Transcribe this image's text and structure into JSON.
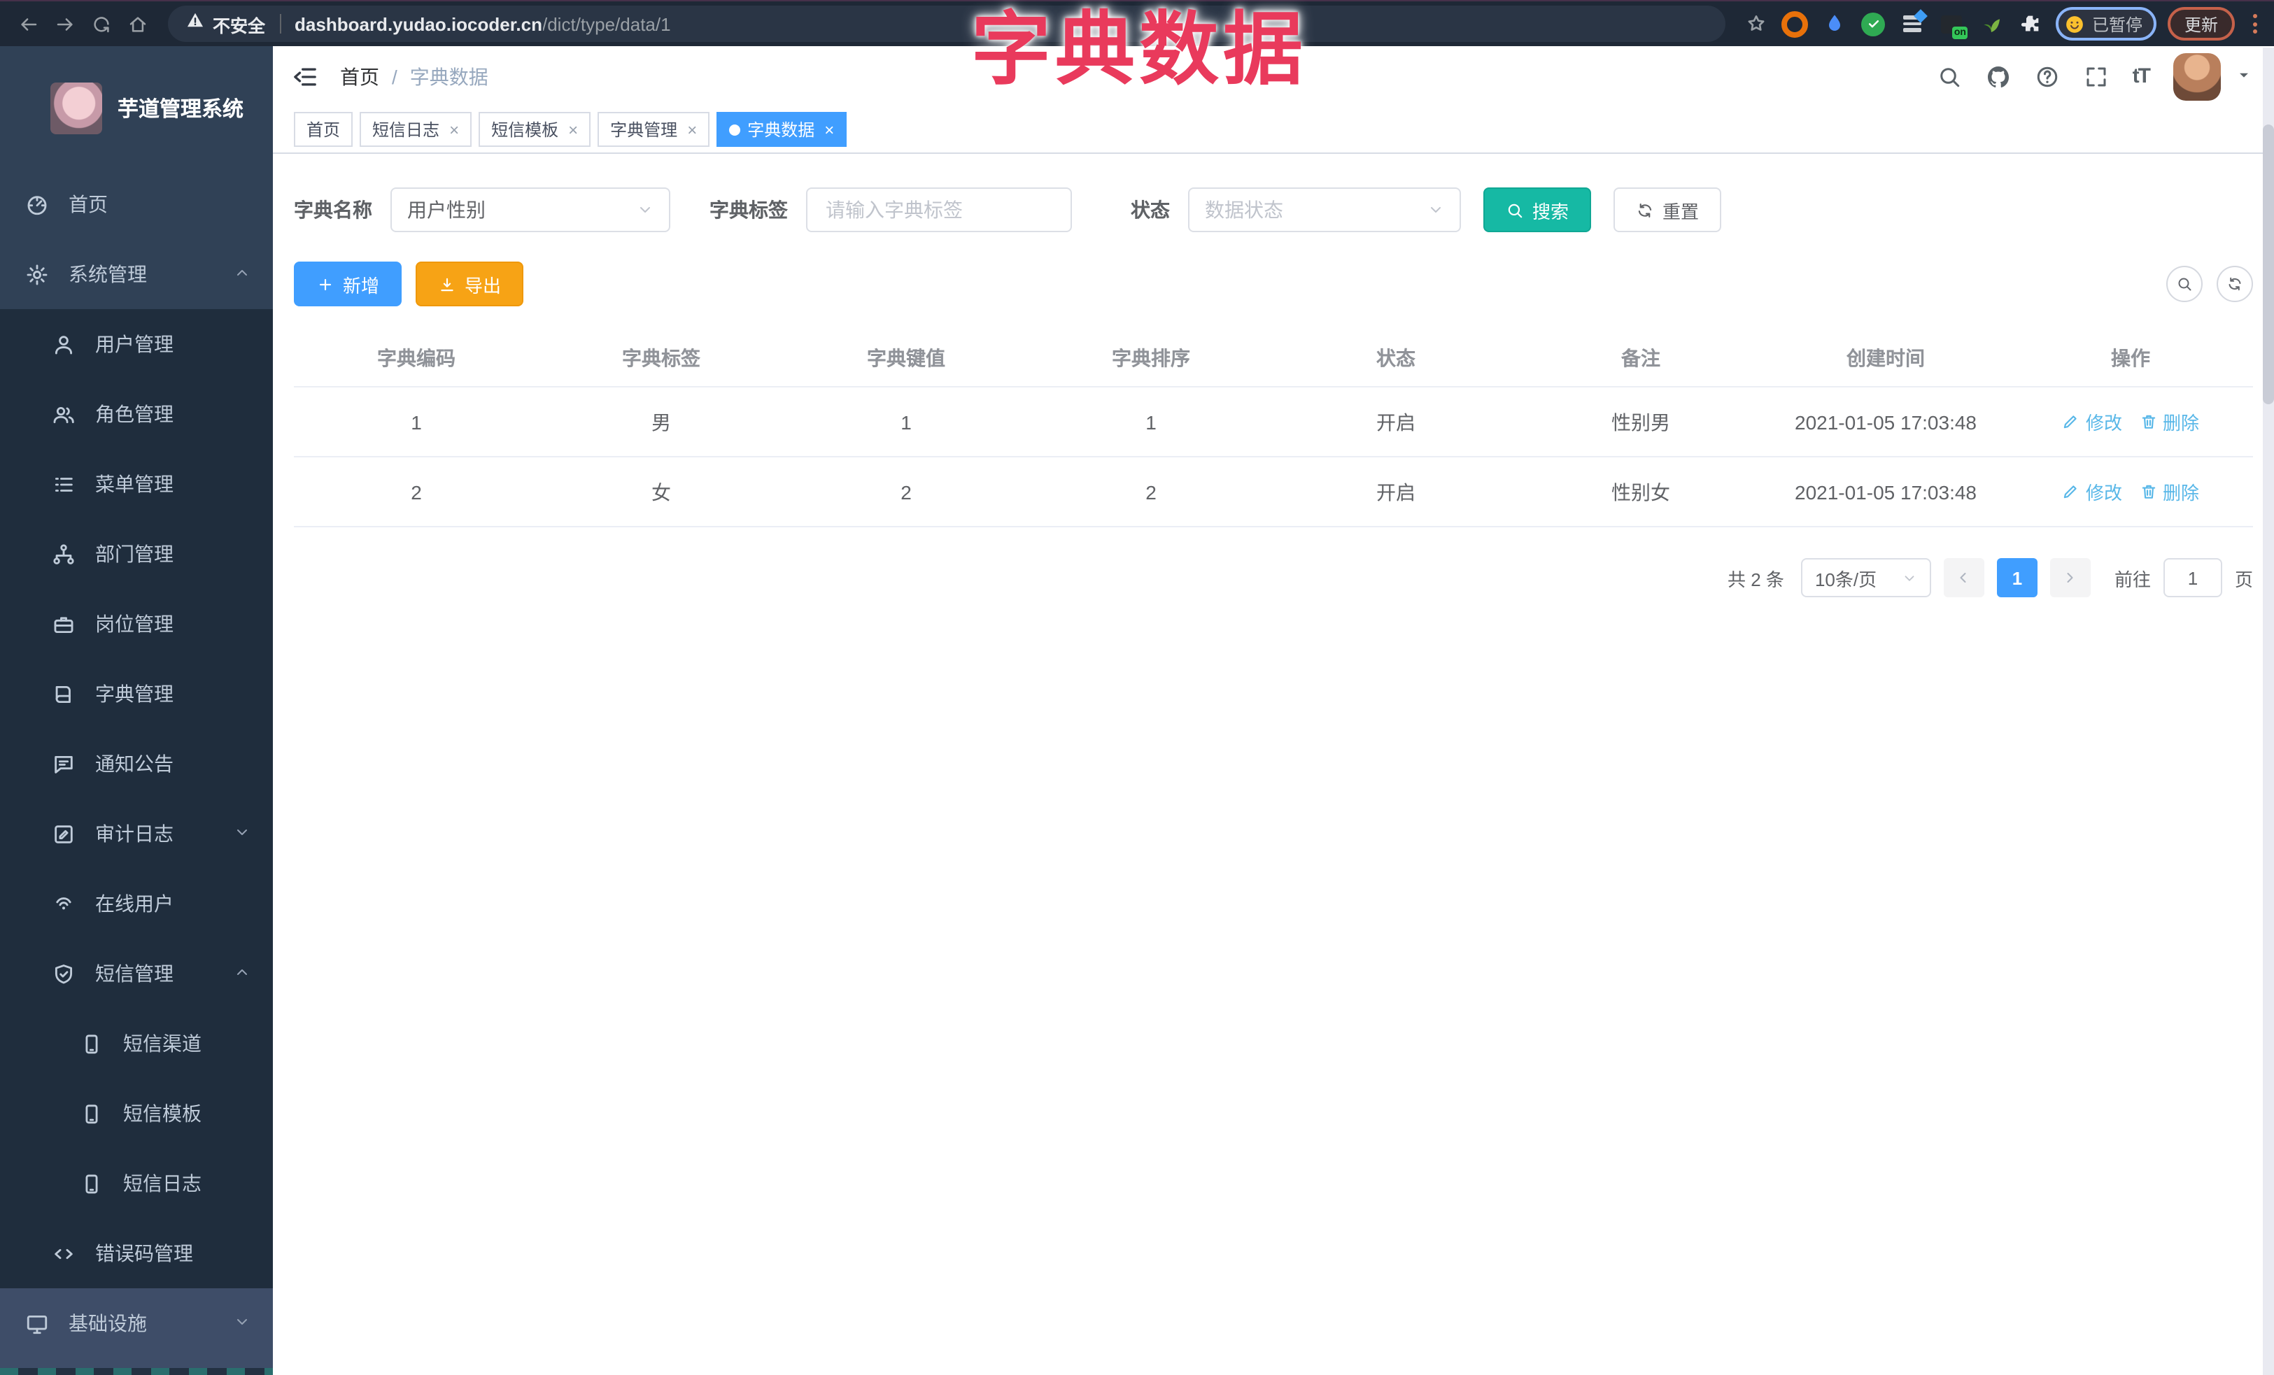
{
  "browser": {
    "security_label": "不安全",
    "url_domain": "dashboard.yudao.iocoder.cn",
    "url_path": "/dict/type/data/1",
    "ext_on_label": "on",
    "paused_label": "已暂停",
    "update_label": "更新"
  },
  "annotation": {
    "text": "字典数据",
    "color": "#e93a5c"
  },
  "sidebar": {
    "title": "芋道管理系统",
    "items": [
      {
        "id": "home",
        "label": "首页",
        "icon": "dashboard",
        "level": 0,
        "chevron": null,
        "section": "top"
      },
      {
        "id": "system",
        "label": "系统管理",
        "icon": "gear",
        "level": 0,
        "chevron": "up",
        "section": "top"
      },
      {
        "id": "user",
        "label": "用户管理",
        "icon": "user",
        "level": 1,
        "chevron": null,
        "section": "sub"
      },
      {
        "id": "role",
        "label": "角色管理",
        "icon": "users",
        "level": 1,
        "chevron": null,
        "section": "sub"
      },
      {
        "id": "menu",
        "label": "菜单管理",
        "icon": "menu-list",
        "level": 1,
        "chevron": null,
        "section": "sub"
      },
      {
        "id": "dept",
        "label": "部门管理",
        "icon": "org-tree",
        "level": 1,
        "chevron": null,
        "section": "sub"
      },
      {
        "id": "post",
        "label": "岗位管理",
        "icon": "briefcase",
        "level": 1,
        "chevron": null,
        "section": "sub"
      },
      {
        "id": "dict",
        "label": "字典管理",
        "icon": "book",
        "level": 1,
        "chevron": null,
        "section": "sub"
      },
      {
        "id": "notice",
        "label": "通知公告",
        "icon": "message",
        "level": 1,
        "chevron": null,
        "section": "sub"
      },
      {
        "id": "audit-log",
        "label": "审计日志",
        "icon": "edit-square",
        "level": 1,
        "chevron": "down",
        "section": "sub"
      },
      {
        "id": "online-user",
        "label": "在线用户",
        "icon": "online",
        "level": 1,
        "chevron": null,
        "section": "sub"
      },
      {
        "id": "sms",
        "label": "短信管理",
        "icon": "shield-check",
        "level": 1,
        "chevron": "up",
        "section": "sub"
      },
      {
        "id": "sms-channel",
        "label": "短信渠道",
        "icon": "phone",
        "level": 2,
        "chevron": null,
        "section": "sub"
      },
      {
        "id": "sms-template",
        "label": "短信模板",
        "icon": "phone",
        "level": 2,
        "chevron": null,
        "section": "sub"
      },
      {
        "id": "sms-log",
        "label": "短信日志",
        "icon": "phone",
        "level": 2,
        "chevron": null,
        "section": "sub"
      },
      {
        "id": "error-code",
        "label": "错误码管理",
        "icon": "code",
        "level": 1,
        "chevron": null,
        "section": "sub"
      },
      {
        "id": "infra",
        "label": "基础设施",
        "icon": "monitor",
        "level": 0,
        "chevron": "down",
        "section": "bottom"
      }
    ]
  },
  "header": {
    "breadcrumb": [
      "首页",
      "字典数据"
    ],
    "separator": "/"
  },
  "tabs": [
    {
      "id": "home",
      "label": "首页",
      "closable": false,
      "active": false
    },
    {
      "id": "sms-log",
      "label": "短信日志",
      "closable": true,
      "active": false
    },
    {
      "id": "sms-template",
      "label": "短信模板",
      "closable": true,
      "active": false
    },
    {
      "id": "dict-type",
      "label": "字典管理",
      "closable": true,
      "active": false
    },
    {
      "id": "dict-data",
      "label": "字典数据",
      "closable": true,
      "active": true
    }
  ],
  "filters": {
    "dict_name": {
      "label": "字典名称",
      "value": "用户性别"
    },
    "dict_label": {
      "label": "字典标签",
      "placeholder": "请输入字典标签"
    },
    "status": {
      "label": "状态",
      "placeholder": "数据状态"
    },
    "search_label": "搜索",
    "reset_label": "重置"
  },
  "toolbar": {
    "add_label": "新增",
    "export_label": "导出"
  },
  "table": {
    "columns": [
      "字典编码",
      "字典标签",
      "字典键值",
      "字典排序",
      "状态",
      "备注",
      "创建时间",
      "操作"
    ],
    "rows": [
      {
        "code": "1",
        "label": "男",
        "value": "1",
        "sort": "1",
        "status": "开启",
        "remark": "性别男",
        "created": "2021-01-05 17:03:48",
        "edit_label": "修改",
        "delete_label": "删除"
      },
      {
        "code": "2",
        "label": "女",
        "value": "2",
        "sort": "2",
        "status": "开启",
        "remark": "性别女",
        "created": "2021-01-05 17:03:48",
        "edit_label": "修改",
        "delete_label": "删除"
      }
    ]
  },
  "pagination": {
    "total": "共 2 条",
    "page_size": "10条/页",
    "current_page": "1",
    "goto_label": "前往",
    "goto_value": "1",
    "page_unit": "页"
  },
  "colors": {
    "primary": "#409eff",
    "teal": "#16b9a4",
    "warning": "#f7a315",
    "annotation": "#e93a5c",
    "sidebar_bg": "#304156",
    "submenu_bg": "#1f2d3d"
  }
}
